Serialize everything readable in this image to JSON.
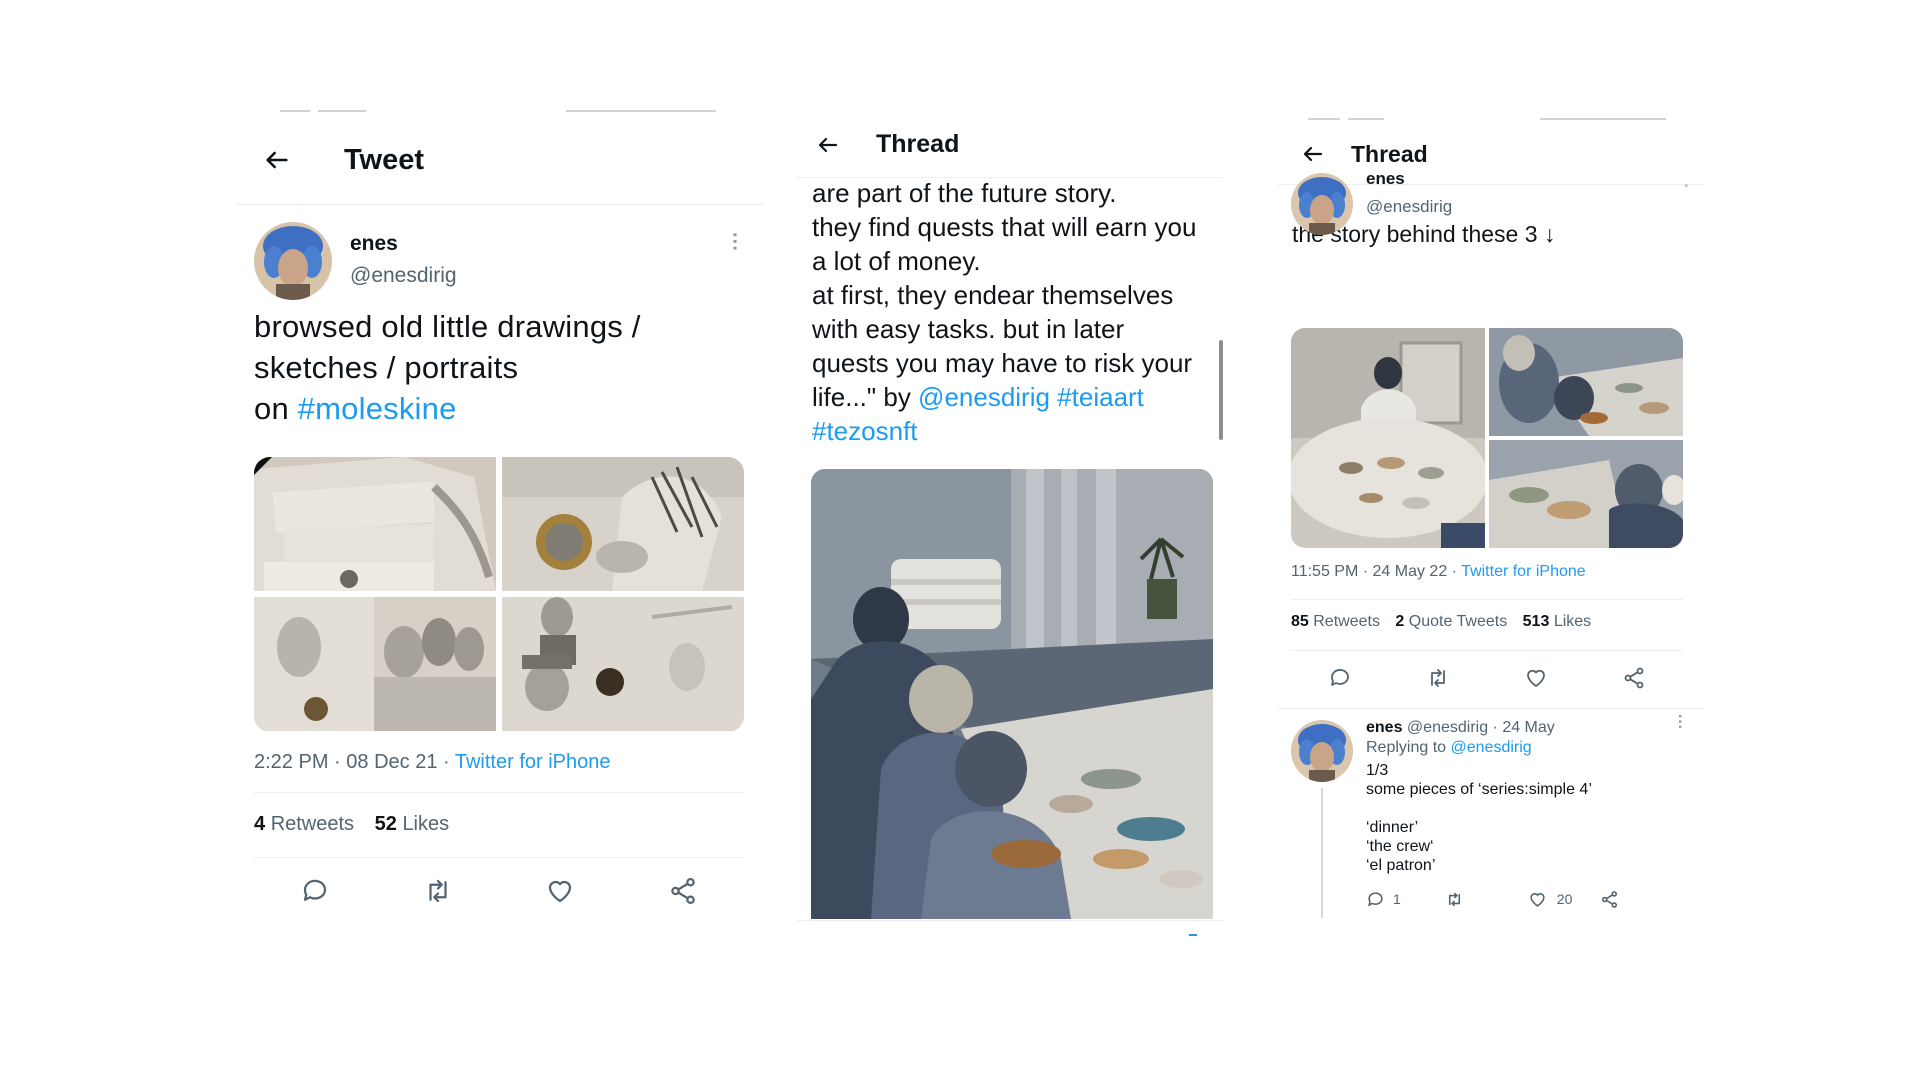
{
  "panel1": {
    "header_title": "Tweet",
    "author_name": "enes",
    "author_handle": "@enesdirig",
    "text_line1": "browsed old little drawings /",
    "text_line2": "sketches / portraits",
    "text_line3_prefix": "on ",
    "hashtag": "#moleskine",
    "time": "2:22 PM",
    "date": "08 Dec 21",
    "source": "Twitter for iPhone",
    "retweets_count": "4",
    "retweets_label": "Retweets",
    "likes_count": "52",
    "likes_label": "Likes"
  },
  "panel2": {
    "header_title": "Thread",
    "lines": [
      "are part of the future story.",
      "they find quests that will earn you",
      "a lot of money.",
      "at first, they endear themselves",
      "with easy tasks. but in later",
      "quests you may have to risk your"
    ],
    "last_line_prefix": "life...\" by ",
    "mention": "@enesdirig",
    "hashtag1": "#teiaart",
    "hashtag2": "#tezosnft"
  },
  "panel3": {
    "header_title": "Thread",
    "partial_name": "enes",
    "author_handle": "@enesdirig",
    "text": "the story behind these 3 ↓",
    "time": "11:55 PM",
    "date": "24 May 22",
    "source": "Twitter for iPhone",
    "retweets_count": "85",
    "retweets_label": "Retweets",
    "quotes_count": "2",
    "quotes_label": "Quote Tweets",
    "likes_count": "513",
    "likes_label": "Likes",
    "reply": {
      "name": "enes",
      "handle": "@enesdirig",
      "date": "24 May",
      "replying_prefix": "Replying to",
      "replying_handle": "@enesdirig",
      "lines": [
        "1/3",
        "some pieces of ‘series:simple 4’",
        "",
        "‘dinner’",
        "‘the crew‘",
        "‘el patron’"
      ],
      "reply_count": "1",
      "like_count": "20"
    }
  }
}
